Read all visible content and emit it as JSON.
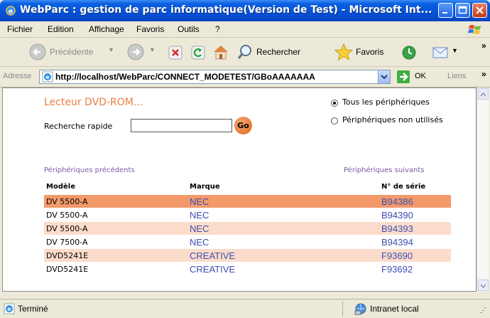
{
  "window": {
    "title": "WebParc : gestion de parc informatique(Version de Test) - Microsoft Int..."
  },
  "menu": {
    "items": [
      "Fichier",
      "Edition",
      "Affichage",
      "Favoris",
      "Outils",
      "?"
    ]
  },
  "toolbar": {
    "back_label": "Précédente",
    "search_label": "Rechercher",
    "favorites_label": "Favoris"
  },
  "address": {
    "label": "Adresse",
    "url": "http://localhost/WebParc/CONNECT_MODETEST/GBoAAAAAAA",
    "go_label": "OK",
    "links_label": "Liens"
  },
  "page": {
    "title": "Lecteur DVD-ROM...",
    "search_label": "Recherche rapide",
    "search_value": "",
    "go_label": "Go",
    "radio_all": "Tous les périphériques",
    "radio_unused": "Périphériques non utilisés",
    "prev_link": "Périphériques précédents",
    "next_link": "Périphériques suivants",
    "columns": [
      "Modèle",
      "Marque",
      "N° de série"
    ],
    "rows": [
      {
        "model": "DV 5500-A",
        "brand": "NEC",
        "serial": "B94386"
      },
      {
        "model": "DV 5500-A",
        "brand": "NEC",
        "serial": "B94390"
      },
      {
        "model": "DV 5500-A",
        "brand": "NEC",
        "serial": "B94393"
      },
      {
        "model": "DV 7500-A",
        "brand": "NEC",
        "serial": "B94394"
      },
      {
        "model": "DVD5241E",
        "brand": "CREATIVE",
        "serial": "F93690"
      },
      {
        "model": "DVD5241E",
        "brand": "CREATIVE",
        "serial": "F93692"
      }
    ]
  },
  "status": {
    "left": "Terminé",
    "zone": "Intranet local"
  },
  "colors": {
    "accent": "#e8813f",
    "row_selected": "#f39a6b",
    "row_odd": "#fbdccb",
    "link_blue": "#3e4fb0",
    "nav_purple": "#7b5aa6"
  }
}
